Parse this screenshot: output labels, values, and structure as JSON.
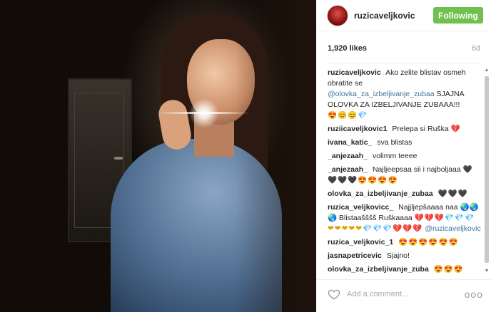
{
  "post": {
    "photo_alt": "",
    "author": "ruzicaveljkovic",
    "follow_label": "Following",
    "likes": "1,920 likes",
    "age": "6d",
    "comment_placeholder": "Add a comment...",
    "more_label": "ooo"
  },
  "comments": [
    {
      "author": "ruzicaveljkovic",
      "text": "Ako zelite blistav osmeh obratite se",
      "mention": "@olovka_za_izbeljivanje_zubaa",
      "text2": " SJAJNA OLOVKA ZA IZBELJIVANJE ZUBAAA!!!",
      "emoji": "😍😊😊💎"
    },
    {
      "author": "ruziicaveljkovic1",
      "text": "Prelepa si Ruška",
      "emoji": "💔"
    },
    {
      "author": "ivana_katic_",
      "text": "sva blistas"
    },
    {
      "author": "_anjezaah_",
      "text": "volimm teeee"
    },
    {
      "author": "_anjezaah_",
      "text": "Najljeepsaa sii i najboljaaa",
      "emoji": "🖤🖤🖤🖤😍😍😍😍"
    },
    {
      "author": "olovka_za_izbeljivanje_zubaa",
      "text": "",
      "emoji": "🖤🖤🖤"
    },
    {
      "author": "ruzica_veljkovicc_",
      "text": "Najjljepšaaaa naa 🌏🌏🌏 Blistaašššš Ruškaaaa",
      "emoji": "💔💔💔💎💎💎❤❤❤❤❤💎💎💎💔💔💔",
      "mention": "@ruzicaveljkovic"
    },
    {
      "author": "ruzica_veljkovic_1",
      "text": "",
      "emoji": "😍😍😍😍😍😍"
    },
    {
      "author": "jasnapetricevic",
      "text": "Sjajno!"
    },
    {
      "author": "olovka_za_izbeljivanje_zuba",
      "text": "",
      "emoji": "😍😍😍"
    }
  ],
  "colors": {
    "follow_green": "#70c050",
    "link_blue": "#3f729b"
  },
  "icons": {
    "heart": "heart-outline-icon",
    "more": "more-options-icon"
  }
}
